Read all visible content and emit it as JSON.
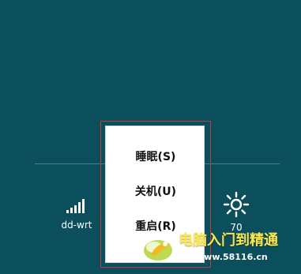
{
  "settings_tray": {
    "network": {
      "label": "dd-wrt",
      "icon": "wifi-signal-icon"
    },
    "brightness": {
      "label": "70",
      "icon": "brightness-icon"
    }
  },
  "power_menu": {
    "options": [
      {
        "label": "睡眠(S)"
      },
      {
        "label": "关机(U)"
      },
      {
        "label": "重启(R)"
      }
    ]
  },
  "watermark": {
    "title": "电脑入门到精通",
    "url": "www.58116.cn"
  },
  "colors": {
    "background": "#0b4e5c",
    "menu_background": "#ffffff",
    "highlight_border": "#c33a3a",
    "watermark_title": "#ffe74a"
  }
}
